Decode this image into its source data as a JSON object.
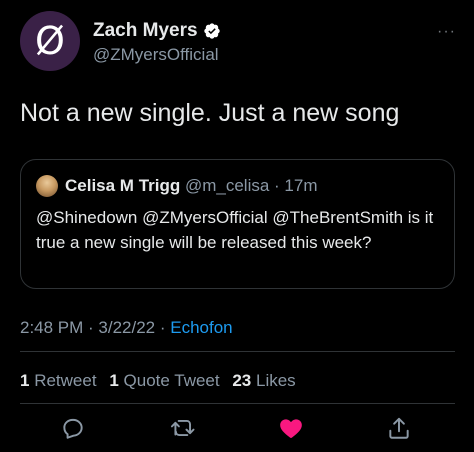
{
  "author": {
    "avatar_glyph": "Ø",
    "name": "Zach Myers",
    "handle": "@ZMyersOfficial"
  },
  "more_label": "···",
  "tweet": {
    "text": "Not a new single. Just a new song"
  },
  "quoted": {
    "name": "Celisa M Trigg",
    "meta": "@m_celisa · 17m",
    "text": "@Shinedown @ZMyersOfficial @TheBrentSmith is it true a new single will be released this week?"
  },
  "meta": {
    "time_date": "2:48 PM · 3/22/22 · ",
    "source": "Echofon"
  },
  "stats": {
    "retweets_count": "1",
    "retweets_label": "Retweet",
    "quotes_count": "1",
    "quotes_label": "Quote Tweet",
    "likes_count": "23",
    "likes_label": "Likes"
  },
  "actions": {
    "reply_icon": "reply-icon",
    "retweet_icon": "retweet-icon",
    "like_icon": "heart-icon",
    "share_icon": "share-icon",
    "like_color": "#f91880",
    "icon_color": "#8b98a5"
  },
  "colors": {
    "background": "#000000",
    "link": "#1d9bf0",
    "verified": "#ffffff"
  }
}
